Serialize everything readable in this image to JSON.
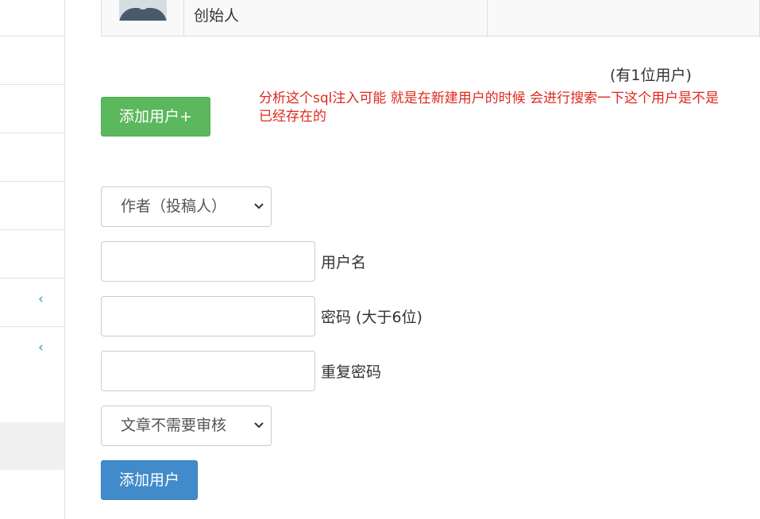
{
  "table": {
    "role_cell": "创始人"
  },
  "user_count_text": "(有1位用户)",
  "add_user_toggle_label": "添加用户+",
  "annotation_text": "分析这个sql注入可能  就是在新建用户的时候  会进行搜索一下这个用户是不是已经存在的",
  "form": {
    "role_select": {
      "selected": "作者（投稿人）"
    },
    "username": {
      "value": "",
      "label": "用户名"
    },
    "password": {
      "value": "",
      "label": "密码 (大于6位)"
    },
    "password_repeat": {
      "value": "",
      "label": "重复密码"
    },
    "review_select": {
      "selected": "文章不需要审核"
    },
    "submit_label": "添加用户"
  },
  "colors": {
    "success": "#5cb85c",
    "primary": "#428bca",
    "annotation": "#e0281e",
    "sidebar_chevron": "#3c8dbc"
  },
  "icons": {
    "sidebar_chevrons": [
      "chevron-left-icon",
      "chevron-left-icon"
    ],
    "select_chevron": "chevron-down-icon"
  }
}
